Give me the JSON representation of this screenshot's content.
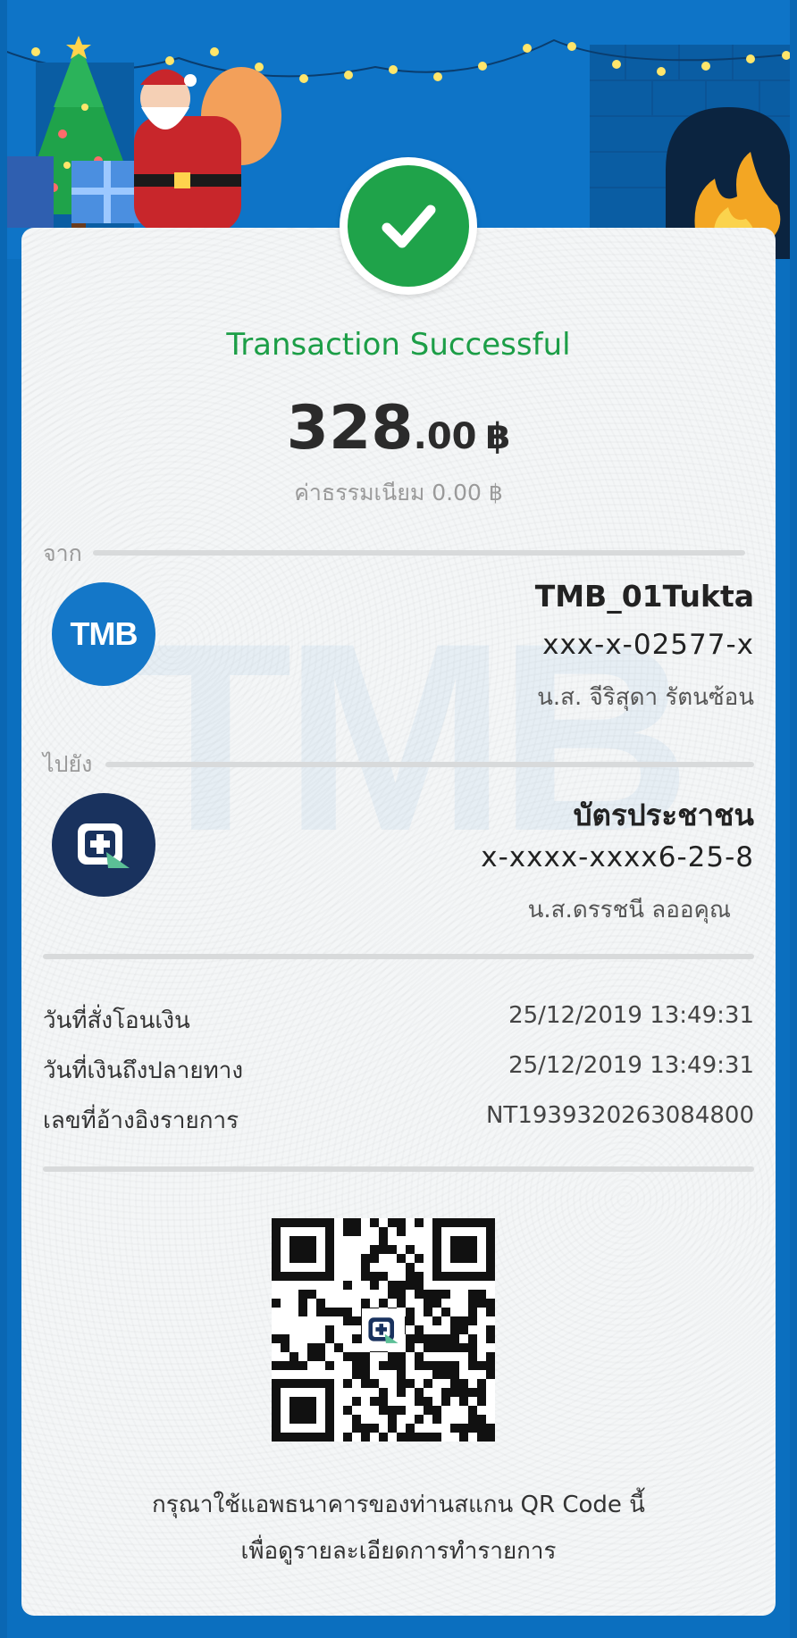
{
  "header": {
    "decoration": "christmas-scene"
  },
  "receipt": {
    "title": "Transaction Successful",
    "amount_int": "328",
    "amount_dec": ".00",
    "currency": "฿",
    "fee_text": "ค่าธรรมเนียม 0.00 ฿"
  },
  "from": {
    "label": "จาก",
    "bank_logo_text": "TMB",
    "name": "TMB_01Tukta",
    "account": "xxx-x-02577-x",
    "holder": "น.ส. จีริสุดา รัตนซ้อน"
  },
  "to": {
    "label": "ไปยัง",
    "name": "บัตรประชาชน",
    "account": "x-xxxx-xxxx6-25-8",
    "holder": "น.ส.ดรรชนี ลออคุณ"
  },
  "details": [
    {
      "label": "วันที่สั่งโอนเงิน",
      "value": "25/12/2019 13:49:31"
    },
    {
      "label": "วันที่เงินถึงปลายทาง",
      "value": "25/12/2019 13:49:31"
    },
    {
      "label": "เลขที่อ้างอิงรายการ",
      "value": "NT1939320263084800"
    }
  ],
  "footer": {
    "line1": "กรุณาใช้แอพธนาคารของท่านสแกน QR Code นี้",
    "line2": "เพื่อดูรายละเอียดการทำรายการ"
  },
  "colors": {
    "brand_blue": "#0e74c7",
    "success_green": "#1fa34a",
    "title_green": "#1c9e47"
  }
}
